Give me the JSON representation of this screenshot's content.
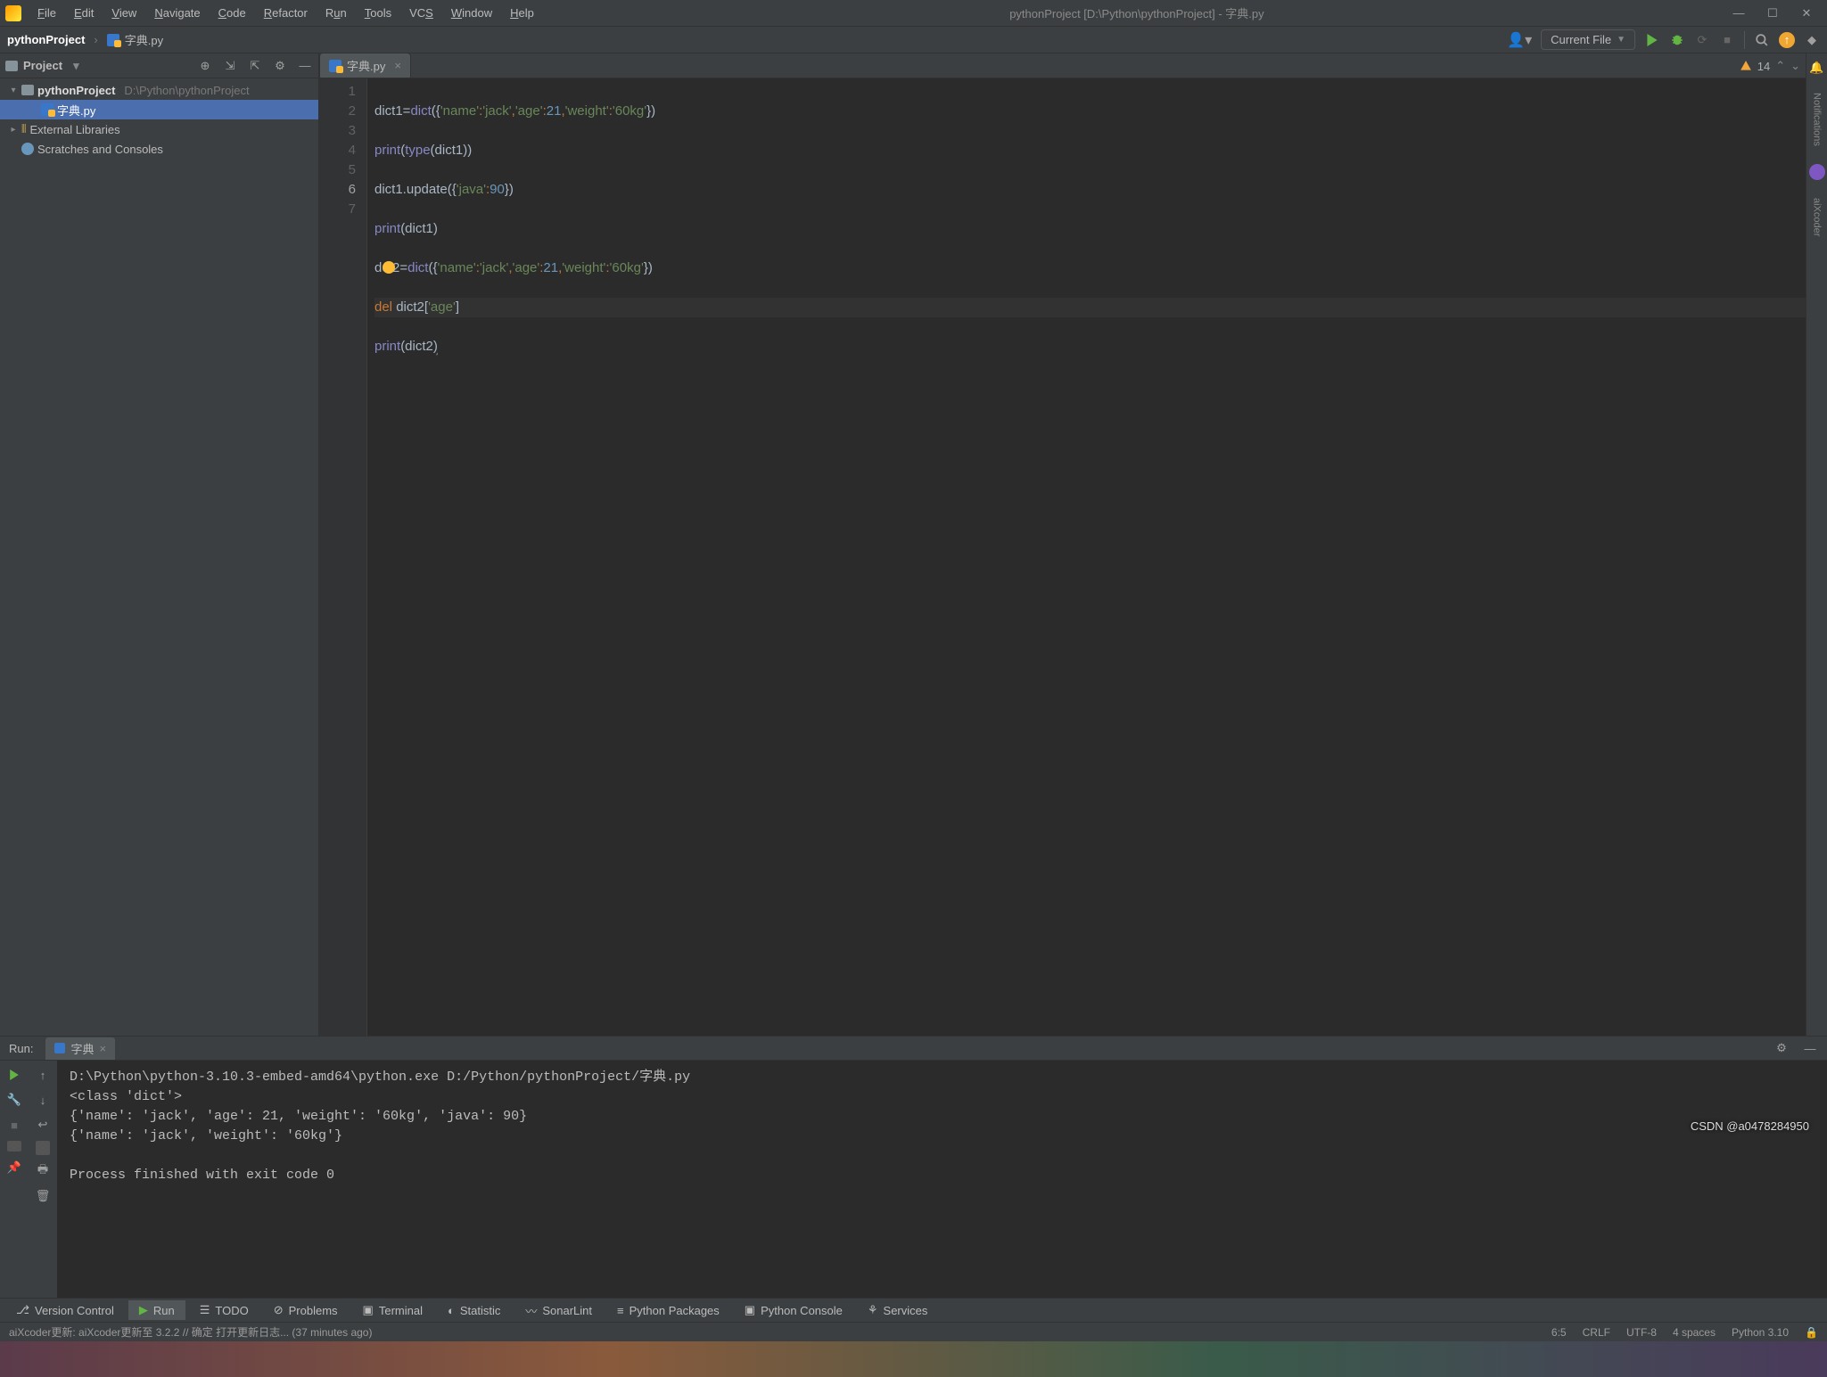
{
  "window": {
    "title": "pythonProject [D:\\Python\\pythonProject] - 字典.py",
    "menus": [
      "File",
      "Edit",
      "View",
      "Navigate",
      "Code",
      "Refactor",
      "Run",
      "Tools",
      "VCS",
      "Window",
      "Help"
    ]
  },
  "breadcrumb": {
    "project": "pythonProject",
    "file": "字典.py"
  },
  "toolbar": {
    "run_config": "Current File"
  },
  "project_view": {
    "label": "Project",
    "root": {
      "name": "pythonProject",
      "path": "D:\\Python\\pythonProject"
    },
    "file": "字典.py",
    "external": "External Libraries",
    "scratches": "Scratches and Consoles"
  },
  "editor": {
    "tab": "字典.py",
    "warnings": "14",
    "lines": [
      "dict1=dict({'name':'jack','age':21,'weight':'60kg'})",
      "print(type(dict1))",
      "dict1.update({'java':90})",
      "print(dict1)",
      "dict2=dict({'name':'jack','age':21,'weight':'60kg'})",
      "del dict2['age']",
      "print(dict2)"
    ],
    "current_line": 6
  },
  "run": {
    "title": "Run:",
    "tab": "字典",
    "output": "D:\\Python\\python-3.10.3-embed-amd64\\python.exe D:/Python/pythonProject/字典.py\n<class 'dict'>\n{'name': 'jack', 'age': 21, 'weight': '60kg', 'java': 90}\n{'name': 'jack', 'weight': '60kg'}\n\nProcess finished with exit code 0"
  },
  "tool_windows": [
    "Version Control",
    "Run",
    "TODO",
    "Problems",
    "Terminal",
    "Statistic",
    "SonarLint",
    "Python Packages",
    "Python Console",
    "Services"
  ],
  "status": {
    "message": "aiXcoder更新: aiXcoder更新至 3.2.2 // 确定   打开更新日志... (37 minutes ago)",
    "pos": "6:5",
    "eol": "CRLF",
    "enc": "UTF-8",
    "indent": "4 spaces",
    "interp": "Python 3.10",
    "watermark": "CSDN @a0478284950"
  },
  "right_rail": {
    "notifications": "Notifications",
    "aixcoder": "aiXcoder"
  }
}
